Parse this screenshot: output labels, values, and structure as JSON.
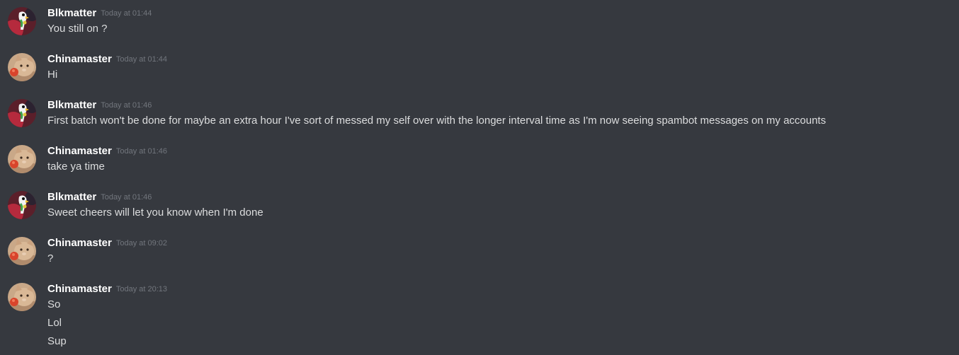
{
  "messages": [
    {
      "avatar": "parrot-avatar-icon",
      "username": "Blkmatter",
      "timestamp": "Today at 01:44",
      "lines": [
        "You still on ?"
      ]
    },
    {
      "avatar": "cat-avatar-icon",
      "username": "Chinamaster",
      "timestamp": "Today at 01:44",
      "lines": [
        "Hi"
      ]
    },
    {
      "avatar": "parrot-avatar-icon",
      "username": "Blkmatter",
      "timestamp": "Today at 01:46",
      "lines": [
        "First batch won't be done for maybe an extra hour I've sort of messed my self over with the longer interval time as I'm now seeing spambot messages on my accounts"
      ]
    },
    {
      "avatar": "cat-avatar-icon",
      "username": "Chinamaster",
      "timestamp": "Today at 01:46",
      "lines": [
        "take ya time"
      ]
    },
    {
      "avatar": "parrot-avatar-icon",
      "username": "Blkmatter",
      "timestamp": "Today at 01:46",
      "lines": [
        "Sweet cheers will let you know when I'm done"
      ]
    },
    {
      "avatar": "cat-avatar-icon",
      "username": "Chinamaster",
      "timestamp": "Today at 09:02",
      "lines": [
        "?"
      ]
    },
    {
      "avatar": "cat-avatar-icon",
      "username": "Chinamaster",
      "timestamp": "Today at 20:13",
      "lines": [
        "So",
        "Lol",
        "Sup"
      ]
    }
  ],
  "colors": {
    "background": "#36393f",
    "username": "#ffffff",
    "timestamp": "#72767d",
    "text": "#dcddde"
  }
}
